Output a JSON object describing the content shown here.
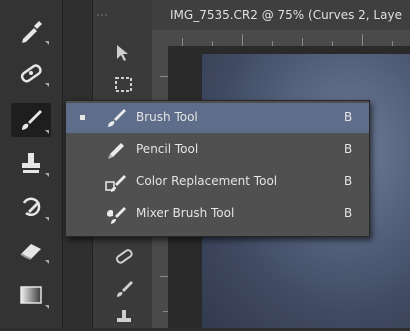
{
  "document": {
    "tab_title": "IMG_7535.CR2 @ 75% (Curves 2, Laye"
  },
  "toolbar": {
    "tools": [
      {
        "name": "eyedropper-tool",
        "icon": "eyedropper-icon"
      },
      {
        "name": "spot-healing-brush-tool",
        "icon": "bandage-icon"
      },
      {
        "name": "brush-tool",
        "icon": "brush-icon",
        "active": true
      },
      {
        "name": "clone-stamp-tool",
        "icon": "stamp-icon"
      },
      {
        "name": "history-brush-tool",
        "icon": "history-brush-icon"
      },
      {
        "name": "eraser-tool",
        "icon": "eraser-icon"
      },
      {
        "name": "gradient-tool",
        "icon": "gradient-icon"
      }
    ]
  },
  "flyout": {
    "items": [
      {
        "label": "Brush Tool",
        "shortcut": "B",
        "icon": "brush-icon",
        "selected": true
      },
      {
        "label": "Pencil Tool",
        "shortcut": "B",
        "icon": "pencil-icon",
        "selected": false
      },
      {
        "label": "Color Replacement Tool",
        "shortcut": "B",
        "icon": "color-replacement-icon",
        "selected": false
      },
      {
        "label": "Mixer Brush Tool",
        "shortcut": "B",
        "icon": "mixer-brush-icon",
        "selected": false
      }
    ]
  },
  "colors": {
    "toolbar_bg": "#333333",
    "menu_bg": "#505050",
    "menu_highlight": "#5e6d8a",
    "text": "#e4e4e4"
  }
}
